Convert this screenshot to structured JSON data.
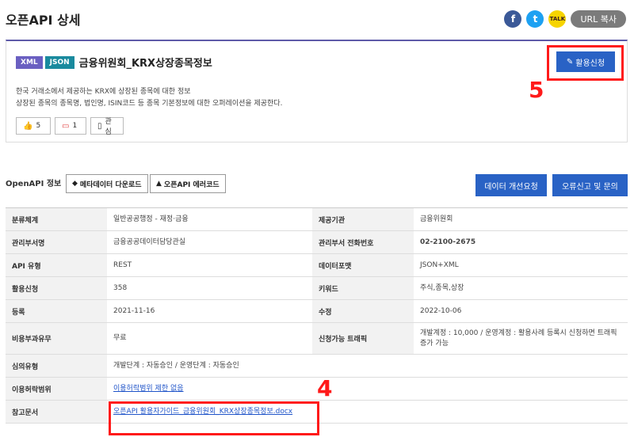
{
  "header": {
    "title": "오픈API 상세",
    "share": {
      "facebook": "f",
      "twitter": "t",
      "kakao": "TALK",
      "url_copy": "URL 복사"
    }
  },
  "detail": {
    "badges": [
      "XML",
      "JSON"
    ],
    "api_name": "금융위원회_KRX상장종목정보",
    "apply_label": "활용신청",
    "desc_line1": "한국 거래소에서 제공하는 KRX에 상장된 종목에 대한 정보",
    "desc_line2": "상장된 종목의 종목명, 법인명, ISIN코드 등 종목 기본정보에 대한 오퍼레이션을 제공한다.",
    "likes": "5",
    "dislikes": "1",
    "interest_label": "관심"
  },
  "info": {
    "label": "OpenAPI 정보",
    "metadata_download": "메타데이터 다운로드",
    "error_code": "오픈API 에러코드",
    "data_improve": "데이터 개선요청",
    "error_report": "오류신고 및 문의"
  },
  "table": {
    "rows": [
      [
        "분류체계",
        "일반공공행정 - 재정·금융",
        "제공기관",
        "금융위원회"
      ],
      [
        "관리부서명",
        "금융공공데이터담당관실",
        "관리부서 전화번호",
        "02-2100-2675"
      ],
      [
        "API 유형",
        "REST",
        "데이터포맷",
        "JSON+XML"
      ],
      [
        "활용신청",
        "358",
        "키워드",
        "주식,종목,상장"
      ],
      [
        "등록",
        "2021-11-16",
        "수정",
        "2022-10-06"
      ],
      [
        "비용부과유무",
        "무료",
        "신청가능 트래픽",
        "개발계정 : 10,000 / 운영계정 : 활용사례 등록시 신청하면 트래픽 증가 가능"
      ]
    ],
    "review_label": "심의유형",
    "review_value": "개발단계 : 자동승인 / 운영단계 : 자동승인",
    "license_label": "이용허락범위",
    "license_value": "이용허락범위 제한 없음",
    "reference_label": "참고문서",
    "reference_value": "오픈API 활용자가이드_금융위원회_KRX상장종목정보.docx"
  },
  "annotations": {
    "num5": "5",
    "num4": "4",
    "color": "#ff1a1a"
  }
}
